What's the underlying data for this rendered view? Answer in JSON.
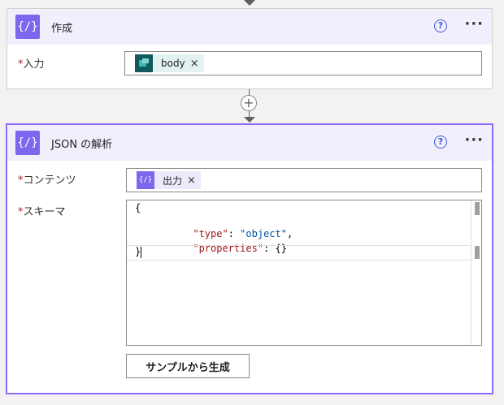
{
  "card1": {
    "title": "作成",
    "icon": "{/}",
    "field": {
      "label": "入力",
      "required_mark": "*"
    },
    "token": {
      "label": "body",
      "remove": "×"
    }
  },
  "card2": {
    "title": "JSON の解析",
    "icon": "{/}",
    "content_field": {
      "label": "コンテンツ",
      "required_mark": "*"
    },
    "token": {
      "label": "出力",
      "remove": "×",
      "icon": "{/}"
    },
    "schema_field": {
      "label": "スキーマ",
      "required_mark": "*"
    },
    "schema_code": {
      "line1": "{",
      "line2_key": "\"type\"",
      "line2_sep": ": ",
      "line2_val": "\"object\"",
      "line2_end": ",",
      "line3_key": "\"properties\"",
      "line3_sep": ": ",
      "line3_val": "{}",
      "line4": "}"
    },
    "generate_button": "サンプルから生成"
  },
  "help_glyph": "?",
  "more_glyph": "···",
  "plus_glyph": "+",
  "colors": {
    "accent": "#7b68ee",
    "header_bg": "#f2effd",
    "selected_border": "#8c6cff",
    "token_bg": "#e4f1f1",
    "body_token_icon": "#0f5a5a"
  }
}
